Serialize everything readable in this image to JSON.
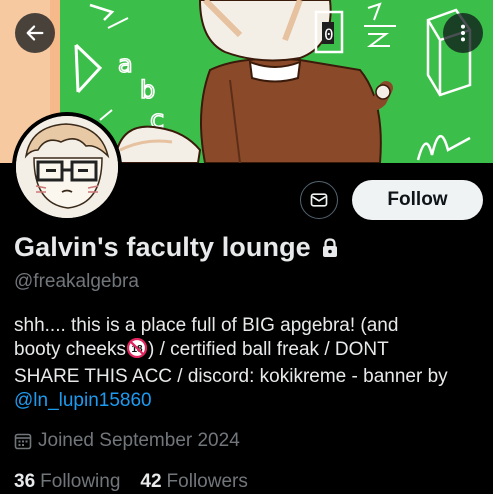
{
  "header": {
    "back_icon": "arrow-left-icon",
    "more_icon": "more-vertical-icon"
  },
  "banner": {
    "chalk_text_abc_a": "a",
    "chalk_text_abc_b": "b",
    "chalk_text_abc_c": "c",
    "colors": {
      "chalkboard": "#3bbf4a",
      "chalk": "#ffffff",
      "coat": "#8a4a2a",
      "wall": "#f5c49a"
    }
  },
  "profile": {
    "display_name": "Galvin's faculty lounge",
    "handle": "@freakalgebra",
    "protected_icon": "lock-icon",
    "bio": {
      "line1": "shh.... this is a place full of BIG apgebra! (and",
      "line2a": "booty cheeks",
      "line2b": ") / certified ball freak / DONT",
      "line3": "SHARE THIS ACC / discord: kokikreme - banner by",
      "mention": "@ln_lupin15860",
      "emoji": "no-one-under-eighteen-emoji",
      "emoji_text": "18"
    },
    "joined": "Joined September 2024",
    "joined_icon": "calendar-icon"
  },
  "actions": {
    "message_icon": "envelope-icon",
    "follow_label": "Follow"
  },
  "stats": {
    "following_count": "36",
    "following_label": "Following",
    "followers_count": "42",
    "followers_label": "Followers"
  },
  "colors": {
    "background": "#000000",
    "text": "#e7e9ea",
    "secondary": "#71767b",
    "link": "#1d9bf0",
    "follow_bg": "#eff3f4"
  }
}
